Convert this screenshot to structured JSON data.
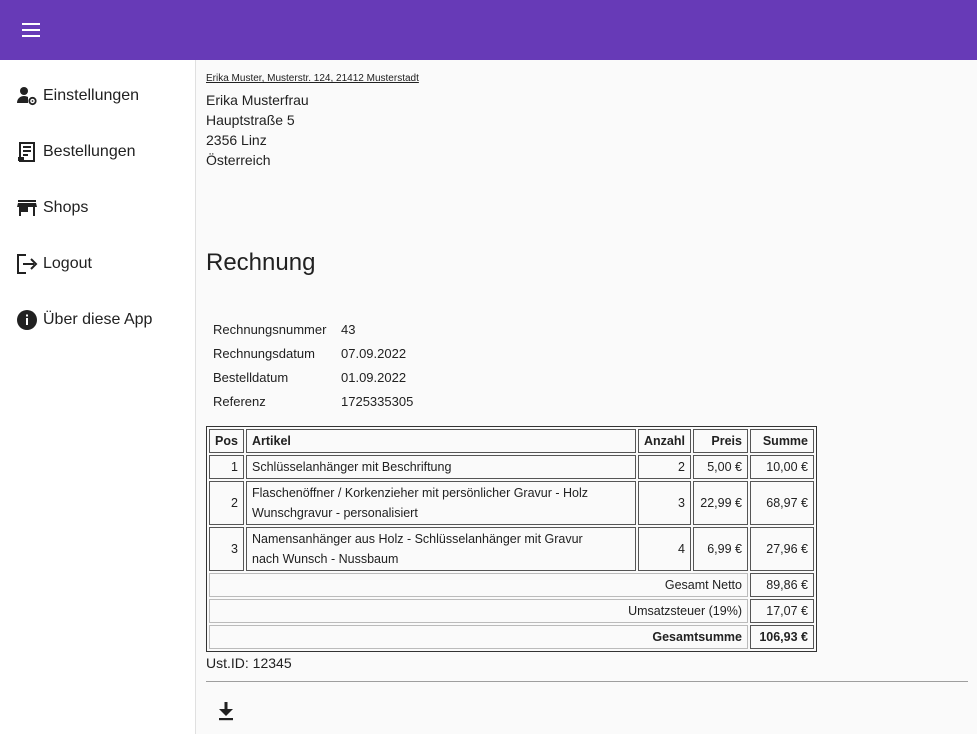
{
  "app": {
    "toolbar_color": "#673ab7",
    "menu_icon": "hamburger-menu-icon"
  },
  "sidebar": {
    "items": [
      {
        "label": "Einstellungen",
        "icon": "user-settings-icon"
      },
      {
        "label": "Bestellungen",
        "icon": "receipt-icon"
      },
      {
        "label": "Shops",
        "icon": "store-icon"
      },
      {
        "label": "Logout",
        "icon": "logout-icon"
      },
      {
        "label": "Über diese App",
        "icon": "info-icon"
      }
    ]
  },
  "invoice": {
    "sender_line": "Erika Muster, Musterstr. 124, 21412 Musterstadt",
    "recipient": [
      "Erika Musterfrau",
      "Hauptstraße 5",
      "2356 Linz",
      "Österreich"
    ],
    "title": "Rechnung",
    "meta": [
      {
        "label": "Rechnungsnummer",
        "value": "43"
      },
      {
        "label": "Rechnungsdatum",
        "value": "07.09.2022"
      },
      {
        "label": "Bestelldatum",
        "value": "01.09.2022"
      },
      {
        "label": "Referenz",
        "value": "1725335305"
      }
    ],
    "table": {
      "headers": {
        "pos": "Pos",
        "artikel": "Artikel",
        "anzahl": "Anzahl",
        "preis": "Preis",
        "summe": "Summe"
      },
      "rows": [
        {
          "pos": "1",
          "artikel_lines": [
            "Schlüsselanhänger mit Beschriftung"
          ],
          "anzahl": "2",
          "preis": "5,00 €",
          "summe": "10,00 €"
        },
        {
          "pos": "2",
          "artikel_lines": [
            "Flaschenöffner / Korkenzieher mit persönlicher Gravur - Holz",
            "Wunschgravur - personalisiert"
          ],
          "anzahl": "3",
          "preis": "22,99 €",
          "summe": "68,97 €"
        },
        {
          "pos": "3",
          "artikel_lines": [
            "Namensanhänger aus Holz - Schlüsselanhänger mit Gravur",
            "nach Wunsch - Nussbaum"
          ],
          "anzahl": "4",
          "preis": "6,99 €",
          "summe": "27,96 €"
        }
      ],
      "totals": [
        {
          "label": "Gesamt Netto",
          "value": "89,86 €"
        },
        {
          "label": "Umsatzsteuer (19%)",
          "value": "17,07 €"
        },
        {
          "label": "Gesamtsumme",
          "value": "106,93 €"
        }
      ]
    },
    "ust_id": "Ust.ID: 12345",
    "download_icon": "download-icon"
  }
}
